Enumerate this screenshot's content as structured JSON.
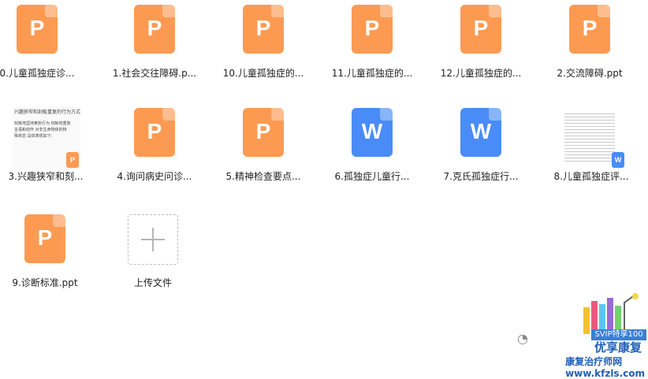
{
  "files": [
    {
      "label": "0.儿童孤独症诊...",
      "type": "ppt",
      "icon": "ppt-file-icon"
    },
    {
      "label": "1.社会交往障碍.p...",
      "type": "ppt",
      "icon": "ppt-file-icon"
    },
    {
      "label": "10.儿童孤独症的...",
      "type": "ppt",
      "icon": "ppt-file-icon"
    },
    {
      "label": "11.儿童孤独症的...",
      "type": "ppt",
      "icon": "ppt-file-icon"
    },
    {
      "label": "12.儿童孤独症的...",
      "type": "ppt",
      "icon": "ppt-file-icon"
    },
    {
      "label": "2.交流障碍.ppt",
      "type": "ppt",
      "icon": "ppt-file-icon"
    },
    {
      "label": "3.兴趣狭窄和刻...",
      "type": "thumb-ppt",
      "icon": "ppt-thumbnail",
      "thumb_lines": [
        "兴趣狭窄和刻板重复的行为方式",
        "刻板地坚持某些行为 刻板地重复",
        "言语和动作 对非生命物体的特",
        "殊依恋 具体表现如下："
      ]
    },
    {
      "label": "4.询问病史问诊...",
      "type": "ppt",
      "icon": "ppt-file-icon"
    },
    {
      "label": "5.精神检查要点...",
      "type": "ppt",
      "icon": "ppt-file-icon"
    },
    {
      "label": "6.孤独症儿童行...",
      "type": "word",
      "icon": "word-file-icon"
    },
    {
      "label": "7.克氏孤独症行...",
      "type": "word",
      "icon": "word-file-icon"
    },
    {
      "label": "8.儿童孤独症评...",
      "type": "thumb-word",
      "icon": "word-thumbnail"
    },
    {
      "label": "9.诊断标准.ppt",
      "type": "ppt",
      "icon": "ppt-file-icon"
    }
  ],
  "upload": {
    "label": "上传文件",
    "icon": "plus-icon"
  },
  "letters": {
    "ppt": "P",
    "word": "W"
  },
  "watermark": {
    "brand": "优享康复",
    "site_cn": "康复治疗师网",
    "site_url": "www.kfzls.com",
    "banner": "SVIP特享100",
    "icon": "wechat-icon"
  },
  "colors": {
    "ppt": "#fd9a52",
    "word": "#4a8cf7",
    "brand": "#1e5fb4"
  }
}
